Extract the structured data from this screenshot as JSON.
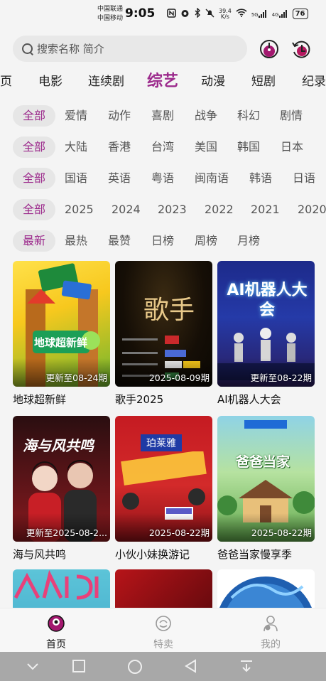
{
  "status_bar": {
    "carrier_top": "中国联通",
    "carrier_bottom": "中国移动",
    "time": "9:05",
    "net_speed": "39.4",
    "net_speed_unit": "K/s",
    "signal_5g": "5G",
    "signal_4g": "4G",
    "battery": "76"
  },
  "search": {
    "placeholder": "搜索名称 简介"
  },
  "category_tabs": [
    "页",
    "电影",
    "连续剧",
    "综艺",
    "动漫",
    "短剧",
    "纪录"
  ],
  "active_tab": "综艺",
  "filters": {
    "genre": [
      "全部",
      "爱情",
      "动作",
      "喜剧",
      "战争",
      "科幻",
      "剧情"
    ],
    "region": [
      "全部",
      "大陆",
      "香港",
      "台湾",
      "美国",
      "韩国",
      "日本"
    ],
    "language": [
      "全部",
      "国语",
      "英语",
      "粤语",
      "闽南语",
      "韩语",
      "日语"
    ],
    "year": [
      "全部",
      "2025",
      "2024",
      "2023",
      "2022",
      "2021",
      "2020"
    ],
    "sort": [
      "最新",
      "最热",
      "最赞",
      "日榜",
      "周榜",
      "月榜"
    ]
  },
  "cards": [
    {
      "title": "地球超新鲜",
      "badge": "更新至08-24期",
      "poster_text": "地球超新鲜"
    },
    {
      "title": "歌手2025",
      "badge": "2025-08-09期",
      "poster_text": "歌手"
    },
    {
      "title": "AI机器人大会",
      "badge": "更新至08-22期",
      "poster_text": "AI机器人大会"
    },
    {
      "title": "海与风共鸣",
      "badge": "更新至2025-08-2...",
      "poster_text": "海与风共鸣"
    },
    {
      "title": "小伙小妹换游记",
      "badge": "2025-08-22期",
      "poster_text": "珀莱雅"
    },
    {
      "title": "爸爸当家慢享季",
      "badge": "2025-08-22期",
      "poster_text": "爸爸当家"
    }
  ],
  "bottom_nav": [
    {
      "label": "首页",
      "icon": "home-icon",
      "active": true
    },
    {
      "label": "特卖",
      "icon": "sale-icon",
      "active": false
    },
    {
      "label": "我的",
      "icon": "profile-icon",
      "active": false
    }
  ],
  "colors": {
    "accent": "#9c2a8c",
    "chip_bg": "#e6e6e6",
    "nav_bar": "#a8a8a8"
  }
}
